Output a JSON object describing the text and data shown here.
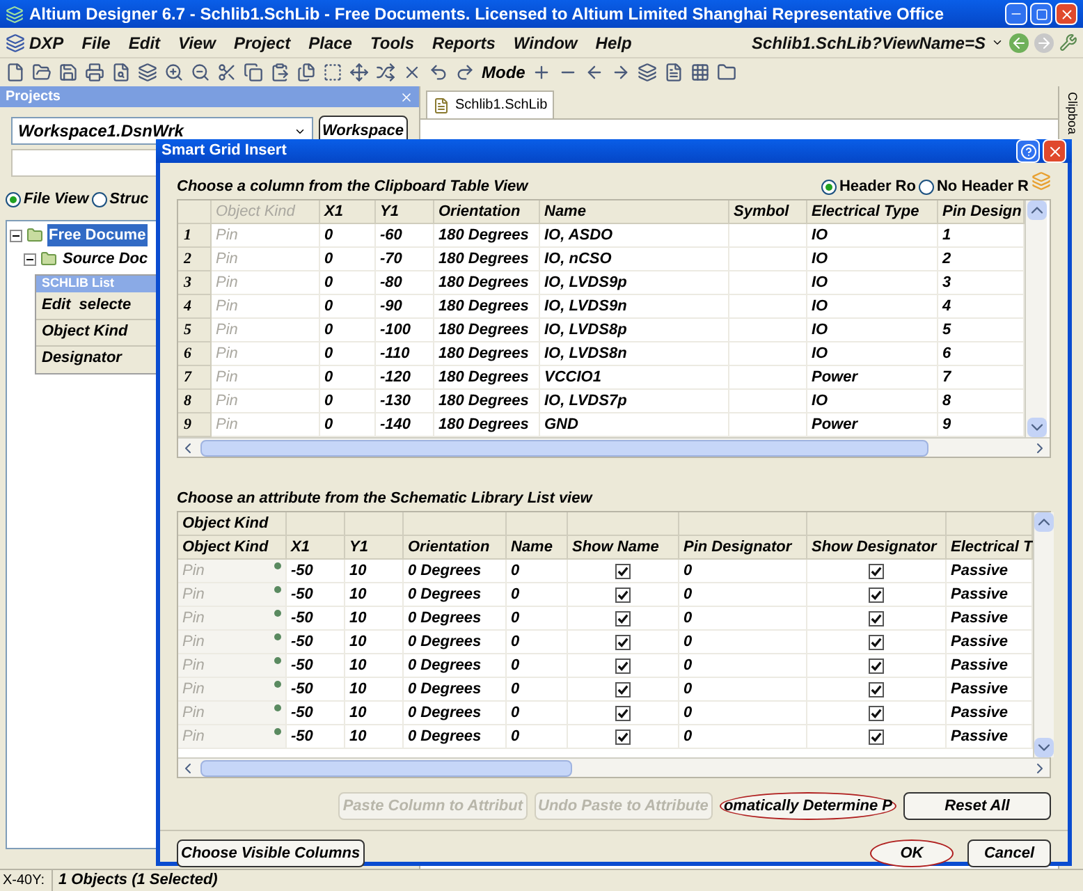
{
  "window": {
    "title": "Altium Designer 6.7 - Schlib1.SchLib - Free Documents. Licensed to Altium Limited Shanghai Representative Office"
  },
  "menu": [
    "DXP",
    "File",
    "Edit",
    "View",
    "Project",
    "Place",
    "Tools",
    "Reports",
    "Window",
    "Help"
  ],
  "address": {
    "value": "Schlib1.SchLib?ViewName=S"
  },
  "toolbar": {
    "mode_label": "Mode"
  },
  "projects_panel": {
    "title": "Projects",
    "workspace": "Workspace1.DsnWrk",
    "workspace_button": "Workspace",
    "views": [
      {
        "label": "File View",
        "selected": true
      },
      {
        "label": "Struc",
        "selected": false
      }
    ],
    "tree": [
      {
        "label": "Free Docume",
        "selected": true,
        "expanded": true,
        "children": [
          {
            "label": "Source Doc",
            "selected": false,
            "expanded": true
          }
        ]
      }
    ]
  },
  "schlib_list": {
    "title": "SCHLIB List",
    "edit_label": "Edit",
    "mode_label": "selecte",
    "rows": [
      "Object Kind",
      "Designator"
    ]
  },
  "document_tab": "Schlib1.SchLib",
  "side_panel": "Clipboa",
  "status_bar": {
    "coords": "X-40Y:",
    "selection": "1 Objects (1 Selected)"
  },
  "dialog": {
    "title": "Smart Grid Insert",
    "clipboard_section": {
      "label": "Choose a column from the Clipboard Table View",
      "header_options": [
        {
          "label": "Header Ro",
          "selected": true
        },
        {
          "label": "No Header R",
          "selected": false
        }
      ],
      "columns": [
        {
          "label": "Object Kind",
          "disabled": true
        },
        {
          "label": "X1",
          "disabled": false
        },
        {
          "label": "Y1",
          "disabled": false
        },
        {
          "label": "Orientation",
          "disabled": false
        },
        {
          "label": "Name",
          "disabled": false
        },
        {
          "label": "Symbol",
          "disabled": false
        },
        {
          "label": "Electrical Type",
          "disabled": false
        },
        {
          "label": "Pin Design",
          "disabled": false
        }
      ],
      "rows": [
        {
          "number": "1",
          "cells": [
            "Pin",
            "0",
            "-60",
            "180 Degrees",
            "IO, ASDO",
            "",
            "IO",
            "1"
          ]
        },
        {
          "number": "2",
          "cells": [
            "Pin",
            "0",
            "-70",
            "180 Degrees",
            "IO, nCSO",
            "",
            "IO",
            "2"
          ]
        },
        {
          "number": "3",
          "cells": [
            "Pin",
            "0",
            "-80",
            "180 Degrees",
            "IO, LVDS9p",
            "",
            "IO",
            "3"
          ]
        },
        {
          "number": "4",
          "cells": [
            "Pin",
            "0",
            "-90",
            "180 Degrees",
            "IO, LVDS9n",
            "",
            "IO",
            "4"
          ]
        },
        {
          "number": "5",
          "cells": [
            "Pin",
            "0",
            "-100",
            "180 Degrees",
            "IO, LVDS8p",
            "",
            "IO",
            "5"
          ]
        },
        {
          "number": "6",
          "cells": [
            "Pin",
            "0",
            "-110",
            "180 Degrees",
            "IO, LVDS8n",
            "",
            "IO",
            "6"
          ]
        },
        {
          "number": "7",
          "cells": [
            "Pin",
            "0",
            "-120",
            "180 Degrees",
            "VCCIO1",
            "",
            "Power",
            "7"
          ]
        },
        {
          "number": "8",
          "cells": [
            "Pin",
            "0",
            "-130",
            "180 Degrees",
            "IO, LVDS7p",
            "",
            "IO",
            "8"
          ]
        },
        {
          "number": "9",
          "cells": [
            "Pin",
            "0",
            "-140",
            "180 Degrees",
            "GND",
            "",
            "Power",
            "9"
          ]
        }
      ]
    },
    "schematic_section": {
      "label": "Choose an attribute from the Schematic Library List view",
      "group_header": "Object Kind",
      "columns": [
        {
          "label": "Object Kind",
          "kind": "muted"
        },
        {
          "label": "X1",
          "kind": "text"
        },
        {
          "label": "Y1",
          "kind": "text"
        },
        {
          "label": "Orientation",
          "kind": "text"
        },
        {
          "label": "Name",
          "kind": "text"
        },
        {
          "label": "Show Name",
          "kind": "check"
        },
        {
          "label": "Pin Designator",
          "kind": "text"
        },
        {
          "label": "Show Designator",
          "kind": "check"
        },
        {
          "label": "Electrical T",
          "kind": "text"
        }
      ],
      "rows": [
        {
          "cells": [
            "Pin",
            "-50",
            "10",
            "0 Degrees",
            "0",
            true,
            "0",
            true,
            "Passive"
          ]
        },
        {
          "cells": [
            "Pin",
            "-50",
            "10",
            "0 Degrees",
            "0",
            true,
            "0",
            true,
            "Passive"
          ]
        },
        {
          "cells": [
            "Pin",
            "-50",
            "10",
            "0 Degrees",
            "0",
            true,
            "0",
            true,
            "Passive"
          ]
        },
        {
          "cells": [
            "Pin",
            "-50",
            "10",
            "0 Degrees",
            "0",
            true,
            "0",
            true,
            "Passive"
          ]
        },
        {
          "cells": [
            "Pin",
            "-50",
            "10",
            "0 Degrees",
            "0",
            true,
            "0",
            true,
            "Passive"
          ]
        },
        {
          "cells": [
            "Pin",
            "-50",
            "10",
            "0 Degrees",
            "0",
            true,
            "0",
            true,
            "Passive"
          ]
        },
        {
          "cells": [
            "Pin",
            "-50",
            "10",
            "0 Degrees",
            "0",
            true,
            "0",
            true,
            "Passive"
          ]
        },
        {
          "cells": [
            "Pin",
            "-50",
            "10",
            "0 Degrees",
            "0",
            true,
            "0",
            true,
            "Passive"
          ]
        }
      ]
    },
    "actions": [
      {
        "label": "Paste Column to Attribut",
        "disabled": true,
        "highlighted": false
      },
      {
        "label": "Undo Paste to Attribute",
        "disabled": true,
        "highlighted": false
      },
      {
        "label": "omatically Determine P",
        "disabled": false,
        "highlighted": true
      },
      {
        "label": "Reset All",
        "disabled": false,
        "highlighted": false
      }
    ],
    "footer_buttons": [
      {
        "label": "Choose Visible Columns",
        "highlighted": false
      },
      {
        "label": "OK",
        "highlighted": true
      },
      {
        "label": "Cancel",
        "highlighted": false
      }
    ]
  }
}
